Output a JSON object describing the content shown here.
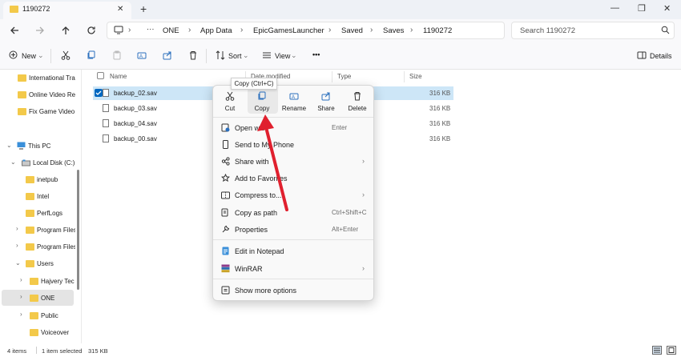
{
  "window": {
    "tab_title": "1190272",
    "tab_close": "✕",
    "tab_add": "+",
    "minimize": "—",
    "maximize": "❐",
    "close": "✕"
  },
  "nav": {
    "breadcrumb": [
      "ONE",
      "App Data",
      "EpicGamesLauncher",
      "Saved",
      "Saves",
      "1190272"
    ],
    "search_placeholder": "Search 1190272",
    "more": "···"
  },
  "toolbar": {
    "new_label": "New",
    "sort_label": "Sort",
    "view_label": "View",
    "more_label": "•••",
    "details_label": "Details"
  },
  "sidebar": {
    "items": [
      {
        "label": "International Tra",
        "type": "folder"
      },
      {
        "label": "Online Video Re",
        "type": "folder"
      },
      {
        "label": "Fix Game Video",
        "type": "folder"
      },
      {
        "label": "This PC",
        "type": "pc"
      },
      {
        "label": "Local Disk (C:)",
        "type": "disk"
      },
      {
        "label": "inetpub",
        "type": "folder"
      },
      {
        "label": "Intel",
        "type": "folder"
      },
      {
        "label": "PerfLogs",
        "type": "folder"
      },
      {
        "label": "Program Files",
        "type": "folder"
      },
      {
        "label": "Program Files",
        "type": "folder"
      },
      {
        "label": "Users",
        "type": "folder"
      },
      {
        "label": "Hajvery Tech",
        "type": "folder"
      },
      {
        "label": "ONE",
        "type": "folder"
      },
      {
        "label": "Public",
        "type": "folder"
      },
      {
        "label": "Voiceover",
        "type": "folder"
      }
    ]
  },
  "columns": {
    "name": "Name",
    "date": "Date modified",
    "type": "Type",
    "size": "Size"
  },
  "files": [
    {
      "name": "backup_02.sav",
      "size": "316 KB",
      "selected": true
    },
    {
      "name": "backup_03.sav",
      "size": "316 KB",
      "selected": false
    },
    {
      "name": "backup_04.sav",
      "size": "316 KB",
      "selected": false
    },
    {
      "name": "backup_00.sav",
      "size": "316 KB",
      "selected": false
    }
  ],
  "context_menu": {
    "quick_actions": [
      {
        "label": "Cut",
        "icon": "scissors-icon"
      },
      {
        "label": "Copy",
        "icon": "copy-icon"
      },
      {
        "label": "Rename",
        "icon": "rename-icon"
      },
      {
        "label": "Share",
        "icon": "share-icon"
      },
      {
        "label": "Delete",
        "icon": "trash-icon"
      }
    ],
    "tooltip": "Copy (Ctrl+C)",
    "items": [
      {
        "label": "Open with",
        "shortcut": "Enter",
        "submenu": false
      },
      {
        "label": "Send to My Phone",
        "shortcut": "",
        "submenu": false
      },
      {
        "label": "Share with",
        "shortcut": "",
        "submenu": true
      },
      {
        "label": "Add to Favorites",
        "shortcut": "",
        "submenu": false
      },
      {
        "label": "Compress to...",
        "shortcut": "",
        "submenu": true
      },
      {
        "label": "Copy as path",
        "shortcut": "Ctrl+Shift+C",
        "submenu": false
      },
      {
        "label": "Properties",
        "shortcut": "Alt+Enter",
        "submenu": false
      },
      {
        "label": "Edit in Notepad",
        "shortcut": "",
        "submenu": false
      },
      {
        "label": "WinRAR",
        "shortcut": "",
        "submenu": true
      },
      {
        "label": "Show more options",
        "shortcut": "",
        "submenu": false
      }
    ]
  },
  "status": {
    "items_count": "4 items",
    "selected": "1 item selected",
    "selected_size": "315 KB"
  },
  "colors": {
    "accent": "#0067c0",
    "selection": "#cde6f7",
    "annotation_arrow": "#e0202e",
    "folder": "#f3c94a"
  }
}
